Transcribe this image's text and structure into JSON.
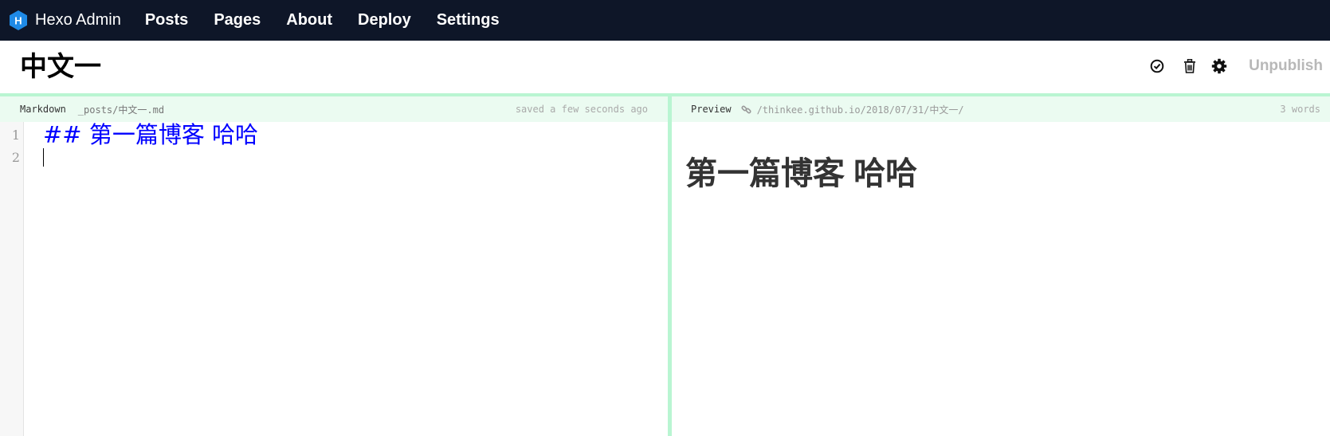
{
  "nav": {
    "brand": "Hexo Admin",
    "brand_icon": "hexo-logo-icon",
    "items": [
      {
        "label": "Posts"
      },
      {
        "label": "Pages"
      },
      {
        "label": "About"
      },
      {
        "label": "Deploy"
      },
      {
        "label": "Settings"
      }
    ]
  },
  "post": {
    "title": "中文一",
    "actions": {
      "check_icon": "check-circle-icon",
      "delete_icon": "trash-icon",
      "settings_icon": "gear-icon",
      "unpublish_label": "Unpublish"
    }
  },
  "editor": {
    "label": "Markdown",
    "path": "_posts/中文一.md",
    "status": "saved a few seconds ago",
    "lines": [
      {
        "num": "1",
        "text": "## 第一篇博客 哈哈"
      },
      {
        "num": "2",
        "text": ""
      }
    ]
  },
  "preview": {
    "label": "Preview",
    "link_icon": "link-icon",
    "url": "/thinkee.github.io/2018/07/31/中文一/",
    "word_count": "3 words",
    "heading": "第一篇博客 哈哈"
  },
  "colors": {
    "nav_bg": "#0e1628",
    "accent_green": "#b9f5d2",
    "header_bg": "#ebfbf1",
    "code_blue": "#0000ff",
    "brand_blue": "#1f8ae6"
  }
}
